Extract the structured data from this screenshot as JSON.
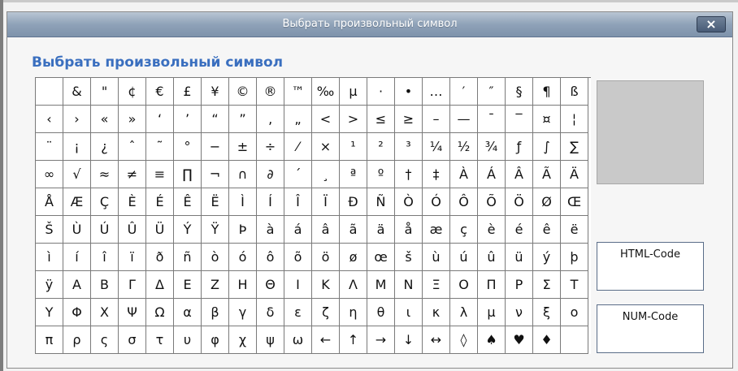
{
  "dialog": {
    "title": "Выбрать произвольный символ",
    "heading": "Выбрать произвольный символ",
    "close_label": "×"
  },
  "symbols": [
    [
      "",
      "&",
      "\"",
      "¢",
      "€",
      "£",
      "¥",
      "©",
      "®",
      "™",
      "‰",
      "µ",
      "·",
      "•",
      "…",
      "′",
      "″",
      "§",
      "¶",
      "ß"
    ],
    [
      "‹",
      "›",
      "«",
      "»",
      "‘",
      "’",
      "“",
      "”",
      "‚",
      "„",
      "<",
      ">",
      "≤",
      "≥",
      "–",
      "—",
      "¯",
      "‾",
      "¤",
      "¦"
    ],
    [
      "¨",
      "¡",
      "¿",
      "ˆ",
      "˜",
      "°",
      "−",
      "±",
      "÷",
      "⁄",
      "×",
      "¹",
      "²",
      "³",
      "¼",
      "½",
      "¾",
      "ƒ",
      "∫",
      "∑"
    ],
    [
      "∞",
      "√",
      "≈",
      "≠",
      "≡",
      "∏",
      "¬",
      "∩",
      "∂",
      "´",
      "¸",
      "ª",
      "º",
      "†",
      "‡",
      "À",
      "Á",
      "Â",
      "Ã",
      "Ä"
    ],
    [
      "Å",
      "Æ",
      "Ç",
      "È",
      "É",
      "Ê",
      "Ë",
      "Ì",
      "Í",
      "Î",
      "Ï",
      "Ð",
      "Ñ",
      "Ò",
      "Ó",
      "Ô",
      "Õ",
      "Ö",
      "Ø",
      "Œ"
    ],
    [
      "Š",
      "Ù",
      "Ú",
      "Û",
      "Ü",
      "Ý",
      "Ÿ",
      "Þ",
      "à",
      "á",
      "â",
      "ã",
      "ä",
      "å",
      "æ",
      "ç",
      "è",
      "é",
      "ê",
      "ë"
    ],
    [
      "ì",
      "í",
      "î",
      "ï",
      "ð",
      "ñ",
      "ò",
      "ó",
      "ô",
      "õ",
      "ö",
      "ø",
      "œ",
      "š",
      "ù",
      "ú",
      "û",
      "ü",
      "ý",
      "þ"
    ],
    [
      "ÿ",
      "Α",
      "Β",
      "Γ",
      "Δ",
      "Ε",
      "Ζ",
      "Η",
      "Θ",
      "Ι",
      "Κ",
      "Λ",
      "Μ",
      "Ν",
      "Ξ",
      "Ο",
      "Π",
      "Ρ",
      "Σ",
      "Τ"
    ],
    [
      "Υ",
      "Φ",
      "Χ",
      "Ψ",
      "Ω",
      "α",
      "β",
      "γ",
      "δ",
      "ε",
      "ζ",
      "η",
      "θ",
      "ι",
      "κ",
      "λ",
      "μ",
      "ν",
      "ξ",
      "ο"
    ],
    [
      "π",
      "ρ",
      "ς",
      "σ",
      "τ",
      "υ",
      "φ",
      "χ",
      "ψ",
      "ω",
      "←",
      "↑",
      "→",
      "↓",
      "↔",
      "◊",
      "♠",
      "♥",
      "♦",
      ""
    ]
  ],
  "panel": {
    "html_code_label": "HTML-Code",
    "num_code_label": "NUM-Code"
  },
  "colors": {
    "heading": "#3a6fbf",
    "titlebar": "#8fa2b8",
    "preview": "#c9c9c9"
  },
  "icons": {
    "close": "close-icon"
  }
}
